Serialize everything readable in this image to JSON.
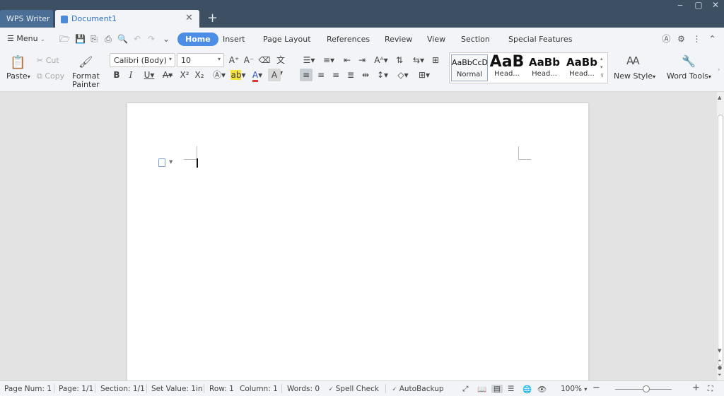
{
  "titlebar": {
    "app_tab": "WPS Writer",
    "doc_tab": "Document1",
    "close": "✕",
    "new_tab": "+",
    "minimize": "▭",
    "restore": "▢",
    "close_window": "✕"
  },
  "menubar": {
    "menu_label": "Menu",
    "tabs": [
      "Home",
      "Insert",
      "Page Layout",
      "References",
      "Review",
      "View",
      "Section",
      "Special Features"
    ],
    "active_tab": "Home"
  },
  "ribbon": {
    "paste": "Paste",
    "cut": "Cut",
    "copy": "Copy",
    "format_painter_1": "Format",
    "format_painter_2": "Painter",
    "font_name": "Calibri (Body)",
    "font_size": "10",
    "styles": [
      {
        "preview": "AaBbCcD",
        "label": "Normal"
      },
      {
        "preview": "AaB",
        "label": "Head..."
      },
      {
        "preview": "AaBb",
        "label": "Head..."
      },
      {
        "preview": "AaBb",
        "label": "Head..."
      }
    ],
    "new_style": "New Style",
    "word_tools": "Word Tools"
  },
  "statusbar": {
    "page_num": "Page Num: 1",
    "page": "Page: 1/1",
    "section": "Section: 1/1",
    "set_value": "Set Value: 1in",
    "row": "Row: 1",
    "column": "Column: 1",
    "words": "Words: 0",
    "spell_check": "Spell Check",
    "autobackup": "AutoBackup",
    "zoom": "100%",
    "zoom_out": "−",
    "zoom_in": "+"
  },
  "colors": {
    "titlebar": "#3d4f63",
    "accent": "#4c8ee6",
    "font_color_red": "#d33",
    "highlight_yellow": "#f5e03c"
  }
}
